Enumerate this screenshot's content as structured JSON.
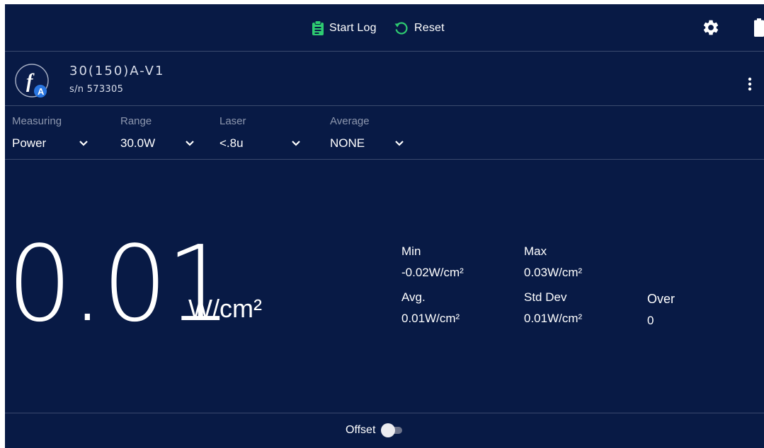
{
  "toolbar": {
    "start_log_label": "Start Log",
    "start_log_icon": "clipboard-icon",
    "reset_label": "Reset",
    "reset_icon": "refresh-icon",
    "settings_icon": "gear-icon",
    "battery_icon": "battery-icon",
    "accent_color": "#2ecc71"
  },
  "device": {
    "logo_letter": "f",
    "logo_badge": "A",
    "model": "30(150)A-V1",
    "serial": "s/n 573305",
    "menu_icon": "more-vert-icon"
  },
  "controls": {
    "measuring": {
      "caption": "Measuring",
      "value": "Power"
    },
    "range": {
      "caption": "Range",
      "value": "30.0W"
    },
    "laser": {
      "caption": "Laser",
      "value": "<.8u"
    },
    "average": {
      "caption": "Average",
      "value": "NONE"
    }
  },
  "reading": {
    "value": "0.01",
    "unit": "W/cm²"
  },
  "stats": {
    "min": {
      "label": "Min",
      "value": "-0.02W/cm²"
    },
    "max": {
      "label": "Max",
      "value": "0.03W/cm²"
    },
    "avg": {
      "label": "Avg.",
      "value": "0.01W/cm²"
    },
    "std": {
      "label": "Std Dev",
      "value": "0.01W/cm²"
    },
    "over": {
      "label": "Over",
      "value": "0"
    }
  },
  "footer": {
    "offset_label": "Offset",
    "offset_on": false
  },
  "colors": {
    "background": "#081a45",
    "divider": "#3b4a6e",
    "badge_blue": "#2a76e0"
  }
}
